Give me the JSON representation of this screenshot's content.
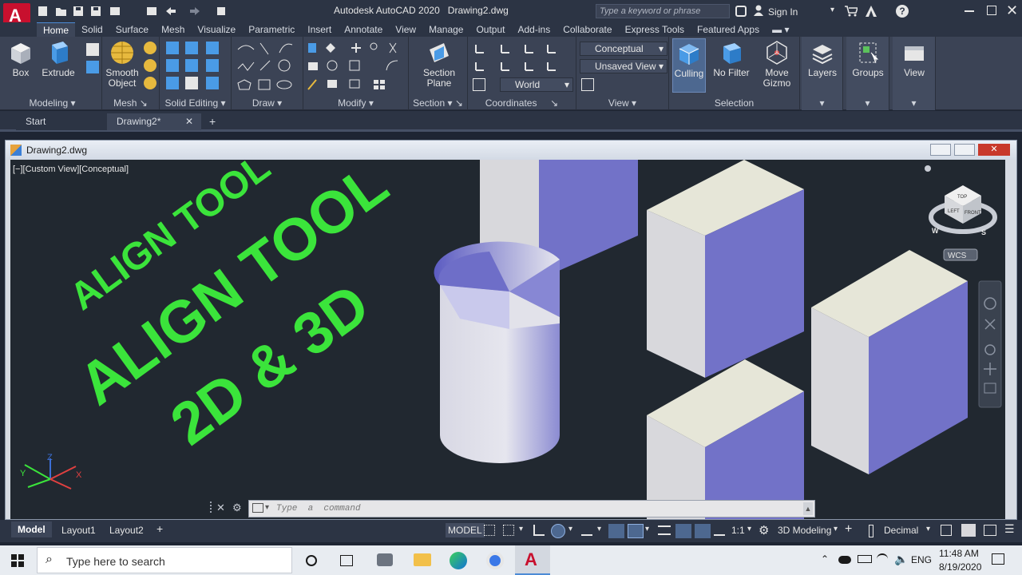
{
  "app": {
    "title": "Autodesk AutoCAD 2020",
    "filename": "Drawing2.dwg",
    "search_placeholder": "Type a keyword or phrase",
    "sign_in": "Sign In"
  },
  "ribbon_tabs": [
    "Home",
    "Solid",
    "Surface",
    "Mesh",
    "Visualize",
    "Parametric",
    "Insert",
    "Annotate",
    "View",
    "Manage",
    "Output",
    "Add-ins",
    "Collaborate",
    "Express Tools",
    "Featured Apps"
  ],
  "ribbon": {
    "modeling": {
      "title": "Modeling",
      "box": "Box",
      "extrude": "Extrude"
    },
    "mesh": {
      "title": "Mesh",
      "smooth_line1": "Smooth",
      "smooth_line2": "Object"
    },
    "solid_editing": {
      "title": "Solid Editing"
    },
    "draw": {
      "title": "Draw"
    },
    "modify": {
      "title": "Modify"
    },
    "section": {
      "title": "Section",
      "plane_line1": "Section",
      "plane_line2": "Plane"
    },
    "coordinates": {
      "title": "Coordinates",
      "world": "World"
    },
    "view": {
      "title": "View",
      "visual_style": "Conceptual",
      "saved_view": "Unsaved View"
    },
    "selection": {
      "title": "Selection",
      "culling": "Culling",
      "no_filter": "No Filter",
      "gizmo_line1": "Move",
      "gizmo_line2": "Gizmo"
    },
    "layers": "Layers",
    "groups": "Groups",
    "view_btn": "View"
  },
  "file_tabs": {
    "start": "Start",
    "drawing": "Drawing2*"
  },
  "document": {
    "title": "Drawing2.dwg",
    "viewport_label": "[−][Custom View][Conceptual]"
  },
  "viewport": {
    "text1": "ALIGN TOOL",
    "text2": "ALIGN TOOL",
    "text3": "2D & 3D",
    "wcs": "WCS",
    "cube_top": "TOP",
    "cube_left": "LEFT",
    "cube_front": "FRONT",
    "compass_w": "W",
    "compass_s": "S",
    "axis_x": "X",
    "axis_y": "Y",
    "axis_z": "Z"
  },
  "command_line": {
    "placeholder": "Type  a  command"
  },
  "status": {
    "layout_tabs": [
      "Model",
      "Layout1",
      "Layout2"
    ],
    "model": "MODEL",
    "scale": "1:1",
    "workspace": "3D Modeling",
    "units": "Decimal"
  },
  "taskbar": {
    "search_placeholder": "Type here to search",
    "lang": "ENG",
    "time": "11:48 AM",
    "date": "8/19/2020"
  },
  "colors": {
    "text_green": "#3be43b",
    "face_light": "#e6e6d8",
    "face_side": "#d8d8dc",
    "face_blue": "#7272c8",
    "accent": "#4c8bd6"
  }
}
